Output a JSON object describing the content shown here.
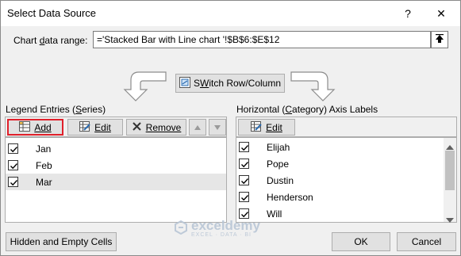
{
  "dialog": {
    "title": "Select Data Source",
    "help": "?",
    "close": "✕"
  },
  "range": {
    "label_pre": "Chart ",
    "label_ul": "d",
    "label_post": "ata range:",
    "value": "='Stacked Bar with Line chart '!$B$6:$E$12"
  },
  "switch": {
    "label_ul": "W",
    "label_pre": "S",
    "label_post": "itch Row/Column"
  },
  "legend": {
    "label_pre": "Legend Entries (",
    "label_ul": "S",
    "label_post": "eries)",
    "add": "Add",
    "edit": "Edit",
    "remove": "Remove",
    "items": [
      {
        "label": "Jan",
        "checked": true
      },
      {
        "label": "Feb",
        "checked": true
      },
      {
        "label": "Mar",
        "checked": true
      }
    ]
  },
  "axis": {
    "label_pre": "Horizontal (",
    "label_ul": "C",
    "label_post": "ategory) Axis Labels",
    "edit": "Edit",
    "items": [
      {
        "label": "Elijah",
        "checked": true
      },
      {
        "label": "Pope",
        "checked": true
      },
      {
        "label": "Dustin",
        "checked": true
      },
      {
        "label": "Henderson",
        "checked": true
      },
      {
        "label": "Will",
        "checked": true
      }
    ]
  },
  "footer": {
    "hidden_cells": "Hidden and Empty Cells",
    "ok": "OK",
    "cancel": "Cancel"
  },
  "watermark": {
    "name": "exceldemy",
    "tagline": "EXCEL · DATA · BI"
  }
}
